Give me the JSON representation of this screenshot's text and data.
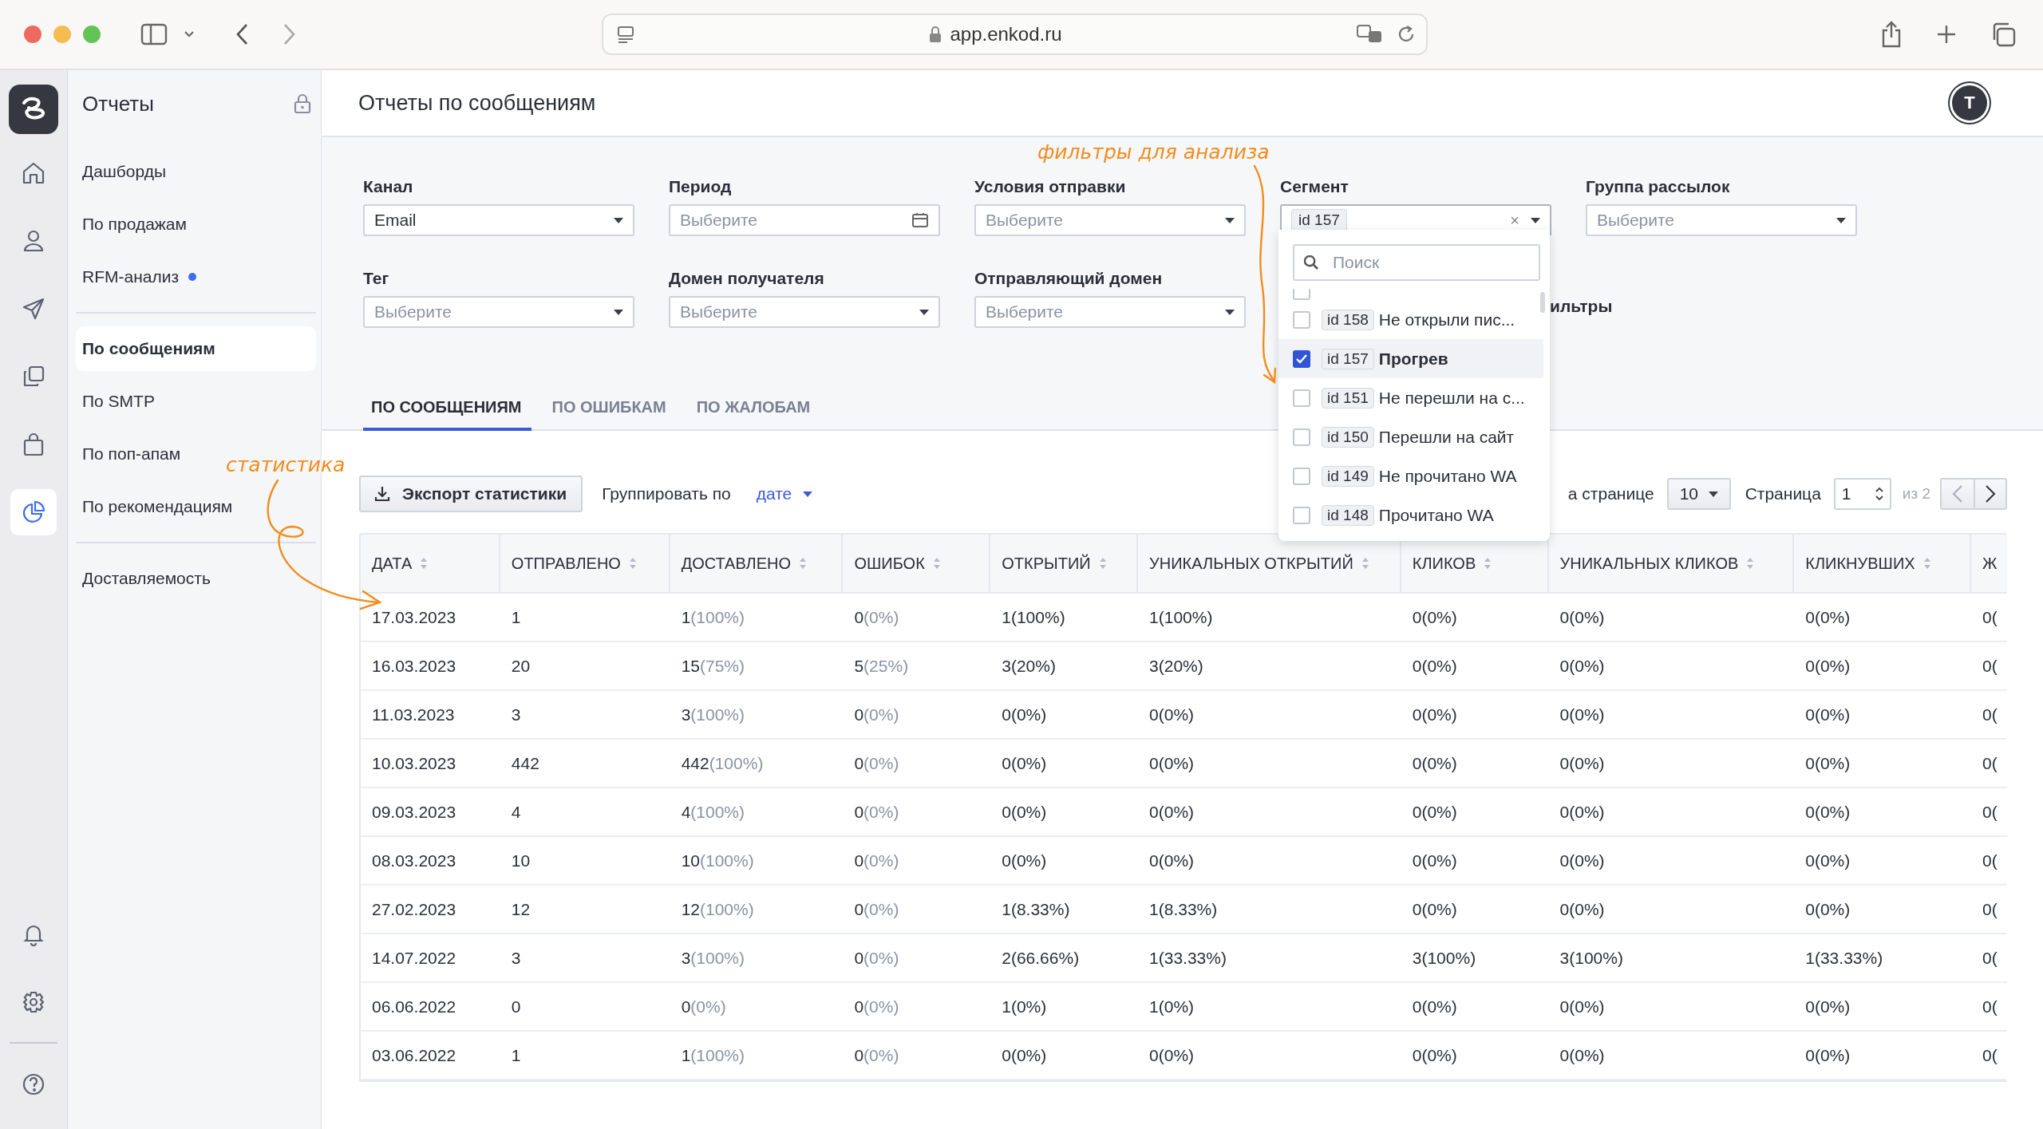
{
  "browser": {
    "url": "app.enkod.ru"
  },
  "rail": {
    "items": [
      {
        "kind": "home",
        "selected": false
      },
      {
        "kind": "user",
        "selected": false
      },
      {
        "kind": "send",
        "selected": false
      },
      {
        "kind": "copy",
        "selected": false
      },
      {
        "kind": "bag",
        "selected": false
      },
      {
        "kind": "pie",
        "selected": true
      }
    ],
    "bottom": [
      {
        "kind": "bell"
      },
      {
        "kind": "gear"
      },
      {
        "kind": "help"
      }
    ]
  },
  "sidebar": {
    "title": "Отчеты",
    "groups": [
      {
        "items": [
          {
            "label": "Дашборды",
            "selected": false,
            "dot": false
          },
          {
            "label": "По продажам",
            "selected": false,
            "dot": false
          },
          {
            "label": "RFM-анализ",
            "selected": false,
            "dot": true
          }
        ]
      },
      {
        "items": [
          {
            "label": "По сообщениям",
            "selected": true,
            "dot": false
          },
          {
            "label": "По SMTP",
            "selected": false,
            "dot": false
          },
          {
            "label": "По поп-апам",
            "selected": false,
            "dot": false
          },
          {
            "label": "По рекомендациям",
            "selected": false,
            "dot": false
          }
        ]
      },
      {
        "items": [
          {
            "label": "Доставляемость",
            "selected": false,
            "dot": false
          }
        ]
      }
    ]
  },
  "header": {
    "title": "Отчеты по сообщениям",
    "avatar": "T"
  },
  "filters": [
    {
      "label": "Канал",
      "kind": "select",
      "value": "Email"
    },
    {
      "label": "Период",
      "kind": "date",
      "placeholder": "Выберите"
    },
    {
      "label": "Условия отправки",
      "kind": "select",
      "placeholder": "Выберите"
    },
    {
      "label": "Сегмент",
      "kind": "tags",
      "tag": "id 157",
      "clear": "×"
    },
    {
      "label": "Группа рассылок",
      "kind": "select",
      "placeholder": "Выберите"
    },
    {
      "label": "Тег",
      "kind": "select",
      "placeholder": "Выберите"
    },
    {
      "label": "Домен получателя",
      "kind": "select",
      "placeholder": "Выберите"
    },
    {
      "label": "Отправляющий домен",
      "kind": "select",
      "placeholder": "Выберите"
    }
  ],
  "hidden_link": "ильтры",
  "segment_dropdown": {
    "search_placeholder": "Поиск",
    "peek_checked": false,
    "items": [
      {
        "id": "id 158",
        "name": "Не открыли пис...",
        "checked": false
      },
      {
        "id": "id 157",
        "name": "Прогрев",
        "checked": true
      },
      {
        "id": "id 151",
        "name": "Не перешли на с...",
        "checked": false
      },
      {
        "id": "id 150",
        "name": "Перешли на сайт",
        "checked": false
      },
      {
        "id": "id 149",
        "name": "Не прочитано WA",
        "checked": false
      },
      {
        "id": "id 148",
        "name": "Прочитано WA",
        "checked": false
      }
    ]
  },
  "tabs": [
    {
      "label": "ПО СООБЩЕНИЯМ",
      "selected": true
    },
    {
      "label": "ПО ОШИБКАМ",
      "selected": false
    },
    {
      "label": "ПО ЖАЛОБАМ",
      "selected": false
    }
  ],
  "toolbar": {
    "export": "Экспорт статистики",
    "group_label": "Группировать по",
    "group_value": "дате",
    "per_page_label": "а странице",
    "per_page": "10",
    "page_label": "Страница",
    "page": "1",
    "page_total": "из 2"
  },
  "annotations": [
    {
      "text": "фильтры для анализа",
      "kind": "filters"
    },
    {
      "text": "статистика",
      "kind": "stats"
    }
  ],
  "table": {
    "columns": [
      {
        "label": "ДАТА",
        "kind": "plain",
        "sort": true
      },
      {
        "label": "ОТПРАВЛЕНО",
        "kind": "plain",
        "sort": true
      },
      {
        "label": "ДОСТАВЛЕНО",
        "kind": "ratio",
        "sort": true
      },
      {
        "label": "ОШИБОК",
        "kind": "ratio",
        "sort": true
      },
      {
        "label": "ОТКРЫТИЙ",
        "kind": "plain",
        "sort": true
      },
      {
        "label": "УНИКАЛЬНЫХ ОТКРЫТИЙ",
        "kind": "plain",
        "sort": true
      },
      {
        "label": "КЛИКОВ",
        "kind": "plain",
        "sort": true
      },
      {
        "label": "УНИКАЛЬНЫХ КЛИКОВ",
        "kind": "plain",
        "sort": true
      },
      {
        "label": "КЛИКНУВШИХ",
        "kind": "plain",
        "sort": true
      },
      {
        "label": "Ж",
        "kind": "plain",
        "sort": false
      }
    ],
    "rows": [
      [
        "17.03.2023",
        "1",
        "1(100%)",
        "0(0%)",
        "1(100%)",
        "1(100%)",
        "0(0%)",
        "0(0%)",
        "0(0%)",
        "0("
      ],
      [
        "16.03.2023",
        "20",
        "15(75%)",
        "5(25%)",
        "3(20%)",
        "3(20%)",
        "0(0%)",
        "0(0%)",
        "0(0%)",
        "0("
      ],
      [
        "11.03.2023",
        "3",
        "3(100%)",
        "0(0%)",
        "0(0%)",
        "0(0%)",
        "0(0%)",
        "0(0%)",
        "0(0%)",
        "0("
      ],
      [
        "10.03.2023",
        "442",
        "442(100%)",
        "0(0%)",
        "0(0%)",
        "0(0%)",
        "0(0%)",
        "0(0%)",
        "0(0%)",
        "0("
      ],
      [
        "09.03.2023",
        "4",
        "4(100%)",
        "0(0%)",
        "0(0%)",
        "0(0%)",
        "0(0%)",
        "0(0%)",
        "0(0%)",
        "0("
      ],
      [
        "08.03.2023",
        "10",
        "10(100%)",
        "0(0%)",
        "0(0%)",
        "0(0%)",
        "0(0%)",
        "0(0%)",
        "0(0%)",
        "0("
      ],
      [
        "27.02.2023",
        "12",
        "12(100%)",
        "0(0%)",
        "1(8.33%)",
        "1(8.33%)",
        "0(0%)",
        "0(0%)",
        "0(0%)",
        "0("
      ],
      [
        "14.07.2022",
        "3",
        "3(100%)",
        "0(0%)",
        "2(66.66%)",
        "1(33.33%)",
        "3(100%)",
        "3(100%)",
        "1(33.33%)",
        "0("
      ],
      [
        "06.06.2022",
        "0",
        "0(0%)",
        "0(0%)",
        "1(0%)",
        "1(0%)",
        "0(0%)",
        "0(0%)",
        "0(0%)",
        "0("
      ],
      [
        "03.06.2022",
        "1",
        "1(100%)",
        "0(0%)",
        "0(0%)",
        "0(0%)",
        "0(0%)",
        "0(0%)",
        "0(0%)",
        "0("
      ]
    ]
  }
}
